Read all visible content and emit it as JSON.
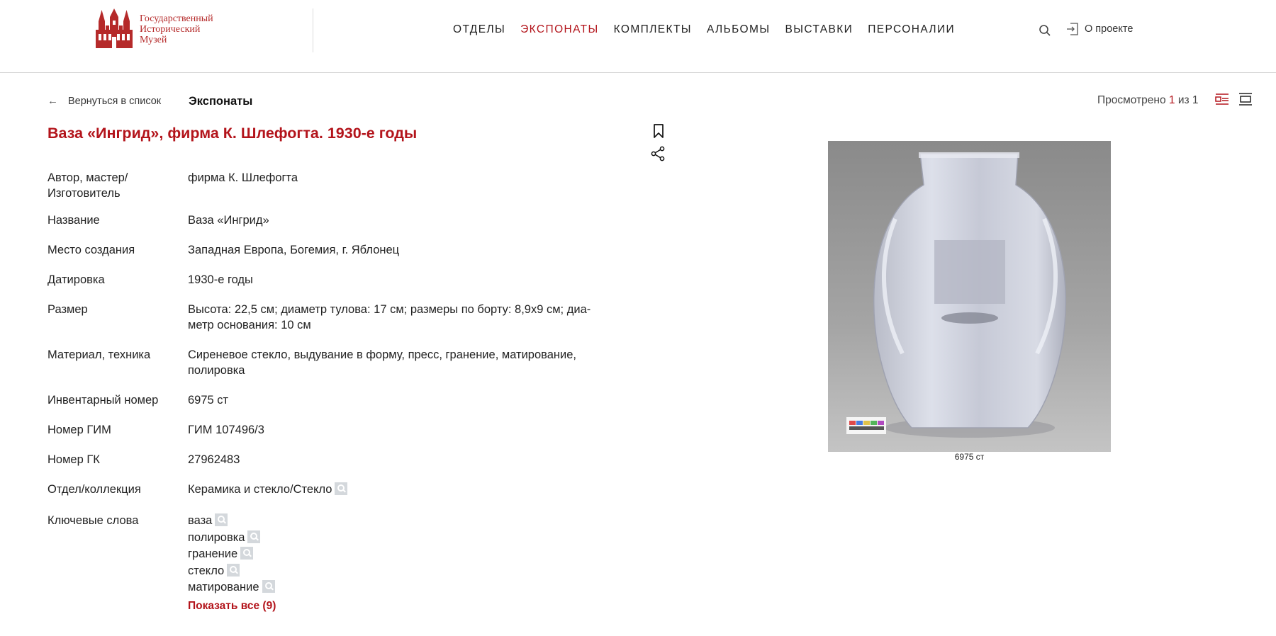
{
  "header": {
    "logo_lines": [
      "Государственный",
      "Исторический",
      "Музей"
    ],
    "nav": [
      {
        "label": "ОТДЕЛЫ",
        "active": false
      },
      {
        "label": "ЭКСПОНАТЫ",
        "active": true
      },
      {
        "label": "КОМПЛЕКТЫ",
        "active": false
      },
      {
        "label": "АЛЬБОМЫ",
        "active": false
      },
      {
        "label": "ВЫСТАВКИ",
        "active": false
      },
      {
        "label": "ПЕРСОНАЛИИ",
        "active": false
      }
    ],
    "about_label": "О проекте",
    "search_icon": "search-icon",
    "login_icon": "login-icon"
  },
  "subbar": {
    "back_label": "Вернуться в список",
    "section_title": "Экспонаты",
    "viewed_prefix": "Просмотрено",
    "viewed_current": "1",
    "viewed_sep": "из",
    "viewed_total": "1"
  },
  "item": {
    "title": "Ваза «Ингрид», фирма К. Шлефогта. 1930-е годы",
    "details": [
      {
        "label": "Автор, мастер/\nИзготовитель",
        "value": "фирма К. Шлефогта"
      },
      {
        "label": "Название",
        "value": "Ваза «Ингрид»"
      },
      {
        "label": "Место создания",
        "value": "Западная Европа, Богемия, г. Яблонец"
      },
      {
        "label": "Датировка",
        "value": "1930-е годы"
      },
      {
        "label": "Размер",
        "value": "Высота: 22,5 см; диаметр тулова: 17 см; размеры по борту: 8,9х9 см; диа-\nметр основания: 10 см"
      },
      {
        "label": "Материал, техника",
        "value": "Сиреневое стекло, выдувание в форму, пресс, гранение, матирование,\nполировка"
      },
      {
        "label": "Инвентарный номер",
        "value": "6975 ст"
      },
      {
        "label": "Номер ГИМ",
        "value": "ГИМ 107496/3"
      },
      {
        "label": "Номер ГК",
        "value": "27962483"
      },
      {
        "label": "Отдел/коллекция",
        "value": "Керамика и стекло/Стекло"
      }
    ],
    "keywords_label": "Ключевые слова",
    "keywords": [
      "ваза",
      "полировка",
      "гранение",
      "стекло",
      "матирование"
    ],
    "show_all": "Показать все (9)",
    "image_caption": "6975 ст"
  },
  "colors": {
    "accent": "#b3141b",
    "logo": "#b52a2a"
  }
}
